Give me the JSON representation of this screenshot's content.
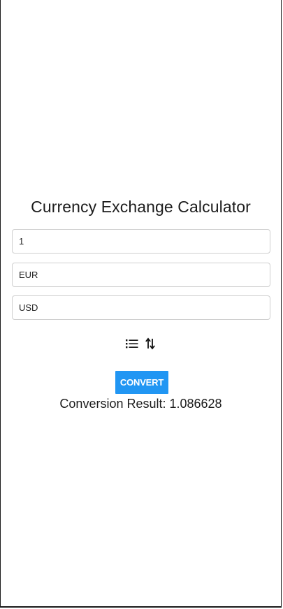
{
  "title": "Currency Exchange Calculator",
  "amount": {
    "value": "1"
  },
  "from_currency": {
    "value": "EUR"
  },
  "to_currency": {
    "value": "USD"
  },
  "icons": {
    "list": "list-icon",
    "swap": "swap-vertical-icon"
  },
  "convert_button": {
    "label": "CONVERT",
    "color": "#2196f3"
  },
  "result": {
    "text": "Conversion Result: 1.086628"
  }
}
